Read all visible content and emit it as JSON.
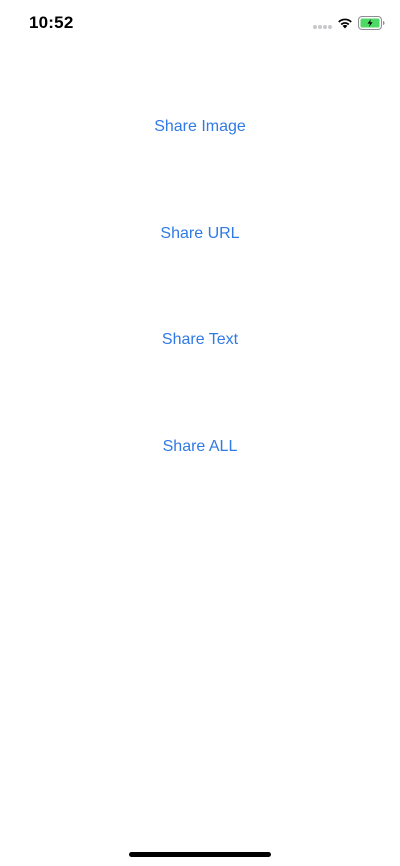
{
  "status_bar": {
    "time": "10:52",
    "icons": [
      "signal-dots-icon",
      "wifi-icon",
      "battery-charging-icon"
    ],
    "battery_color": "#4cd964"
  },
  "buttons": {
    "share_image": "Share Image",
    "share_url": "Share URL",
    "share_text": "Share Text",
    "share_all": "Share ALL"
  },
  "colors": {
    "accent": "#2f7ae5",
    "background": "#ffffff"
  }
}
